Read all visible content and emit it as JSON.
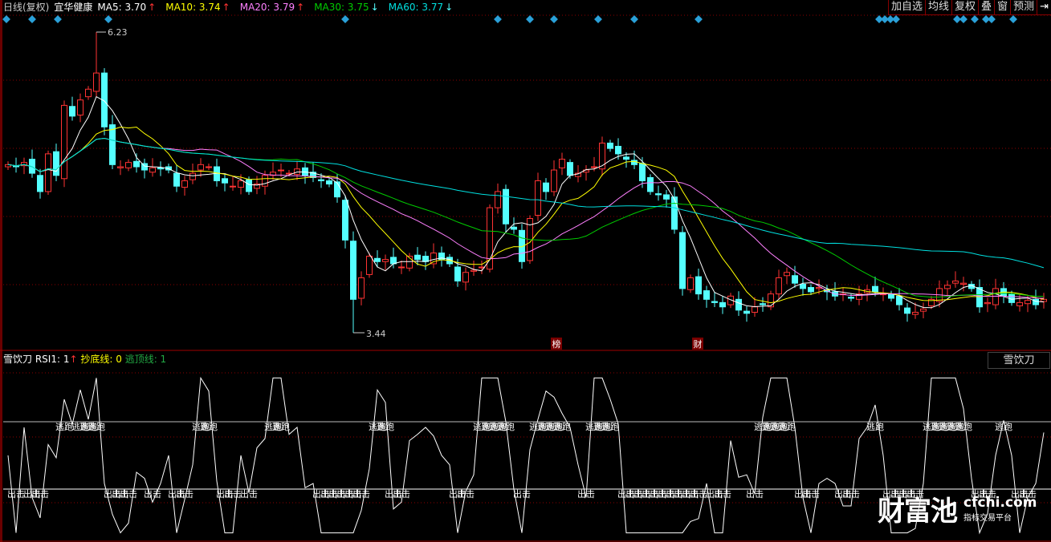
{
  "header": {
    "period": "日线(复权)",
    "stock_name": "宜华健康",
    "ma": [
      {
        "label": "MA5: 3.70",
        "color": "#ffffff",
        "arrow": "up"
      },
      {
        "label": "MA10: 3.74",
        "color": "#ffff00",
        "arrow": "up"
      },
      {
        "label": "MA20: 3.79",
        "color": "#ff80ff",
        "arrow": "up"
      },
      {
        "label": "MA30: 3.75",
        "color": "#00cc00",
        "arrow": "down"
      },
      {
        "label": "MA60: 3.77",
        "color": "#00e0e0",
        "arrow": "down"
      }
    ],
    "buttons": [
      "加自选",
      "均线",
      "复权",
      "叠",
      "窗",
      "预测"
    ],
    "exit_icon": "arrow-to-right-icon"
  },
  "indicator": {
    "name": "雪饮刀",
    "rsi_label": "RSI1: 1",
    "bottom_line_label": "抄底线: 0",
    "top_line_label": "逃顶线: 1",
    "button": "雪饮刀",
    "escape_label": "逃跑",
    "attack_label": "出击"
  },
  "markers": {
    "bang": "榜",
    "cai": "财"
  },
  "watermark": {
    "brand": "财富池",
    "domain": "cfchi.com",
    "slogan": "指标交易平台"
  },
  "colors": {
    "up": "#ff3333",
    "down": "#54ffff",
    "grid": "#8b0000"
  },
  "chart_data": {
    "type": "candlestick",
    "title": "宜华健康 日线(复权)",
    "annotations": {
      "high": "6.23",
      "low": "3.44"
    },
    "ylim": [
      3.44,
      6.23
    ],
    "closes": [
      5.0,
      4.98,
      5.02,
      4.92,
      4.75,
      5.1,
      4.9,
      5.55,
      5.45,
      5.6,
      5.7,
      5.85,
      5.35,
      5.0,
      4.98,
      5.02,
      4.98,
      4.95,
      4.97,
      4.96,
      4.95,
      4.8,
      4.85,
      4.92,
      5.0,
      4.98,
      4.85,
      4.83,
      4.8,
      4.85,
      4.75,
      4.82,
      4.9,
      4.93,
      4.95,
      4.92,
      4.96,
      4.9,
      4.88,
      4.85,
      4.82,
      4.7,
      4.3,
      3.75,
      3.95,
      4.15,
      4.1,
      4.12,
      4.08,
      4.05,
      4.15,
      4.12,
      4.1,
      4.18,
      4.12,
      4.08,
      3.92,
      4.0,
      4.02,
      4.05,
      4.6,
      4.75,
      4.45,
      4.4,
      4.1,
      4.5,
      4.85,
      4.75,
      4.95,
      5.05,
      4.9,
      4.92,
      4.95,
      4.98,
      5.2,
      5.15,
      5.1,
      5.05,
      5.0,
      4.85,
      4.75,
      4.72,
      4.68,
      4.4,
      3.85,
      3.95,
      3.8,
      3.75,
      3.72,
      3.68,
      3.78,
      3.65,
      3.62,
      3.68,
      3.7,
      3.8,
      3.95,
      4.0,
      3.9,
      3.85,
      3.82,
      3.86,
      3.82,
      3.78,
      3.8,
      3.76,
      3.8,
      3.84,
      3.82,
      3.8,
      3.76,
      3.7,
      3.62,
      3.63,
      3.66,
      3.75,
      3.85,
      3.88,
      3.92,
      3.9,
      3.85,
      3.68,
      3.72,
      3.85,
      3.78,
      3.72,
      3.72,
      3.74,
      3.7,
      3.75
    ],
    "ma_periods": [
      5,
      10,
      20,
      30,
      60
    ],
    "indicator_thresholds": {
      "escape": 70,
      "attack": 30
    }
  }
}
